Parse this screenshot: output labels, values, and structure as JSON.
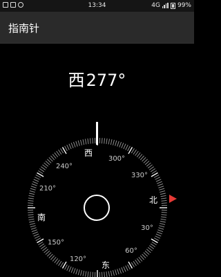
{
  "status_bar": {
    "time": "13:34",
    "network": "4G",
    "battery": "99%",
    "left_icons": [
      "image-icon",
      "square-icon",
      "alarm-icon"
    ]
  },
  "app_bar": {
    "title": "指南针"
  },
  "heading": {
    "direction": "西",
    "degrees": "277°"
  },
  "dial": {
    "cardinal": {
      "north": "北",
      "east": "东",
      "south": "南",
      "west": "西"
    },
    "degree_labels": [
      "30°",
      "60°",
      "120°",
      "150°",
      "210°",
      "240°",
      "300°",
      "330°"
    ],
    "north_marker_color": "#e53935"
  }
}
